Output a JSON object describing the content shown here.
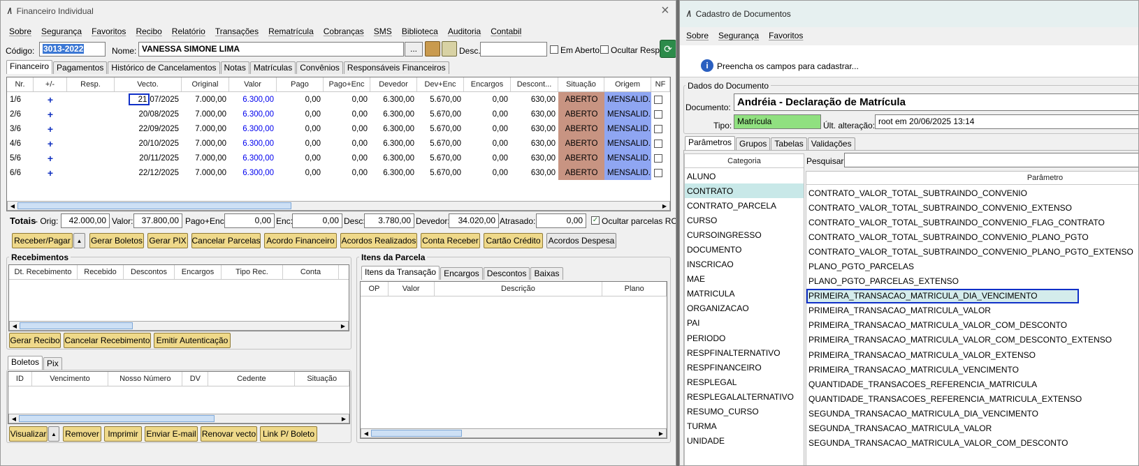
{
  "left": {
    "title": "Financeiro Individual",
    "close": "×",
    "menu": [
      "Sobre",
      "Segurança",
      "Favoritos",
      "Recibo",
      "Relatório",
      "Transações",
      "Rematrícula",
      "Cobranças",
      "SMS",
      "Biblioteca",
      "Auditoria",
      "Contabil"
    ],
    "codigo_label": "Código:",
    "codigo_value": "3013-2022",
    "nome_label": "Nome:",
    "nome_value": "VANESSA SIMONE LIMA",
    "dots": "...",
    "desc_label": "Desc.:",
    "desc_value": "",
    "em_aberto": "Em Aberto",
    "ocultar_resp": "Ocultar Resp.",
    "tabs": [
      "Financeiro",
      "Pagamentos",
      "Histórico de Cancelamentos",
      "Notas",
      "Matrículas",
      "Convênios",
      "Responsáveis Financeiros"
    ],
    "grid_headers": [
      "Nr.",
      "+/-",
      "Resp.",
      "Vecto.",
      "Original",
      "Valor",
      "Pago",
      "Pago+Enc",
      "Devedor",
      "Dev+Enc",
      "Encargos",
      "Descont...",
      "Situação",
      "Origem",
      "NF"
    ],
    "rows": [
      {
        "nr": "1/6",
        "pm": "+",
        "resp": "",
        "vecto": "21/07/2025",
        "vecto_day": "21",
        "vecto_rest": "07/2025",
        "original": "7.000,00",
        "valor": "6.300,00",
        "pago": "0,00",
        "pagoenc": "0,00",
        "devedor": "6.300,00",
        "devenc": "5.670,00",
        "encargos": "0,00",
        "desconto": "630,00",
        "situacao": "ABERTO",
        "origem": "MENSALID..."
      },
      {
        "nr": "2/6",
        "pm": "+",
        "resp": "",
        "vecto": "20/08/2025",
        "original": "7.000,00",
        "valor": "6.300,00",
        "pago": "0,00",
        "pagoenc": "0,00",
        "devedor": "6.300,00",
        "devenc": "5.670,00",
        "encargos": "0,00",
        "desconto": "630,00",
        "situacao": "ABERTO",
        "origem": "MENSALID..."
      },
      {
        "nr": "3/6",
        "pm": "+",
        "resp": "",
        "vecto": "22/09/2025",
        "original": "7.000,00",
        "valor": "6.300,00",
        "pago": "0,00",
        "pagoenc": "0,00",
        "devedor": "6.300,00",
        "devenc": "5.670,00",
        "encargos": "0,00",
        "desconto": "630,00",
        "situacao": "ABERTO",
        "origem": "MENSALID..."
      },
      {
        "nr": "4/6",
        "pm": "+",
        "resp": "",
        "vecto": "20/10/2025",
        "original": "7.000,00",
        "valor": "6.300,00",
        "pago": "0,00",
        "pagoenc": "0,00",
        "devedor": "6.300,00",
        "devenc": "5.670,00",
        "encargos": "0,00",
        "desconto": "630,00",
        "situacao": "ABERTO",
        "origem": "MENSALID..."
      },
      {
        "nr": "5/6",
        "pm": "+",
        "resp": "",
        "vecto": "20/11/2025",
        "original": "7.000,00",
        "valor": "6.300,00",
        "pago": "0,00",
        "pagoenc": "0,00",
        "devedor": "6.300,00",
        "devenc": "5.670,00",
        "encargos": "0,00",
        "desconto": "630,00",
        "situacao": "ABERTO",
        "origem": "MENSALID..."
      },
      {
        "nr": "6/6",
        "pm": "+",
        "resp": "",
        "vecto": "22/12/2025",
        "original": "7.000,00",
        "valor": "6.300,00",
        "pago": "0,00",
        "pagoenc": "0,00",
        "devedor": "6.300,00",
        "devenc": "5.670,00",
        "encargos": "0,00",
        "desconto": "630,00",
        "situacao": "ABERTO",
        "origem": "MENSALID..."
      }
    ],
    "totals": {
      "label": "Totais",
      "orig_label": "- Orig:",
      "orig": "42.000,00",
      "valor_label": "Valor:",
      "valor": "37.800,00",
      "pagoenc_label": "Pago+Enc:",
      "pagoenc": "0,00",
      "enc_label": "Enc:",
      "enc": "0,00",
      "desc_label": "Desc:",
      "desc": "3.780,00",
      "devedor_label": "Devedor:",
      "devedor": "34.020,00",
      "atrasado_label": "Atrasado:",
      "atrasado": "0,00",
      "ocultar": "Ocultar parcelas RC"
    },
    "actions": [
      "Receber/Pagar",
      "Gerar Boletos",
      "Gerar PIX",
      "Cancelar Parcelas",
      "Acordo Financeiro",
      "Acordos Realizados",
      "Conta Receber",
      "Cartão Crédito",
      "Acordos Despesa"
    ],
    "recebimentos": {
      "title": "Recebimentos",
      "headers": [
        "Dt. Recebimento",
        "Recebido",
        "Descontos",
        "Encargos",
        "Tipo Rec.",
        "Conta"
      ],
      "buttons": [
        "Gerar Recibo",
        "Cancelar Recebimento",
        "Emitir Autenticação"
      ]
    },
    "itens": {
      "title": "Itens da Parcela",
      "tabs": [
        "Itens da Transação",
        "Encargos",
        "Descontos",
        "Baixas"
      ],
      "headers": [
        "OP",
        "Valor",
        "Descrição",
        "Plano"
      ]
    },
    "boletos": {
      "tabs": [
        "Boletos",
        "Pix"
      ],
      "headers": [
        "ID",
        "Vencimento",
        "Nosso Número",
        "DV",
        "Cedente",
        "Situação"
      ],
      "buttons": [
        "Visualizar",
        "Remover",
        "Imprimir",
        "Enviar E-mail",
        "Renovar vecto",
        "Link P/ Boleto"
      ]
    }
  },
  "right": {
    "title": "Cadastro de Documentos",
    "menu": [
      "Sobre",
      "Segurança",
      "Favoritos"
    ],
    "info": "Preencha os campos para cadastrar...",
    "group_title": "Dados do Documento",
    "documento_label": "Documento:",
    "documento_value": "Andréia - Declaração de Matrícula",
    "tipo_label": "Tipo:",
    "tipo_value": "Matrícula",
    "ult_label": "Últ. alteração:",
    "ult_value": "root em 20/06/2025 13:14",
    "tabs": [
      "Parâmetros",
      "Grupos",
      "Tabelas",
      "Validações"
    ],
    "categoria_header": "Categoria",
    "pesquisar_label": "Pesquisar:",
    "parametro_header": "Parâmetro",
    "categorias": [
      "ALUNO",
      "CONTRATO",
      "CONTRATO_PARCELA",
      "CURSO",
      "CURSOINGRESSO",
      "DOCUMENTO",
      "INSCRICAO",
      "MAE",
      "MATRICULA",
      "ORGANIZACAO",
      "PAI",
      "PERIODO",
      "RESPFINALTERNATIVO",
      "RESPFINANCEIRO",
      "RESPLEGAL",
      "RESPLEGALALTERNATIVO",
      "RESUMO_CURSO",
      "TURMA",
      "UNIDADE"
    ],
    "parametros": [
      "CONTRATO_VALOR_TOTAL_SUBTRAINDO_CONVENIO",
      "CONTRATO_VALOR_TOTAL_SUBTRAINDO_CONVENIO_EXTENSO",
      "CONTRATO_VALOR_TOTAL_SUBTRAINDO_CONVENIO_FLAG_CONTRATO",
      "CONTRATO_VALOR_TOTAL_SUBTRAINDO_CONVENIO_PLANO_PGTO",
      "CONTRATO_VALOR_TOTAL_SUBTRAINDO_CONVENIO_PLANO_PGTO_EXTENSO",
      "PLANO_PGTO_PARCELAS",
      "PLANO_PGTO_PARCELAS_EXTENSO",
      "PRIMEIRA_TRANSACAO_MATRICULA_DIA_VENCIMENTO",
      "PRIMEIRA_TRANSACAO_MATRICULA_VALOR",
      "PRIMEIRA_TRANSACAO_MATRICULA_VALOR_COM_DESCONTO",
      "PRIMEIRA_TRANSACAO_MATRICULA_VALOR_COM_DESCONTO_EXTENSO",
      "PRIMEIRA_TRANSACAO_MATRICULA_VALOR_EXTENSO",
      "PRIMEIRA_TRANSACAO_MATRICULA_VENCIMENTO",
      "QUANTIDADE_TRANSACOES_REFERENCIA_MATRICULA",
      "QUANTIDADE_TRANSACOES_REFERENCIA_MATRICULA_EXTENSO",
      "SEGUNDA_TRANSACAO_MATRICULA_DIA_VENCIMENTO",
      "SEGUNDA_TRANSACAO_MATRICULA_VALOR",
      "SEGUNDA_TRANSACAO_MATRICULA_VALOR_COM_DESCONTO"
    ]
  },
  "colors": {
    "valor_blue": "#0000ee",
    "situacao_bg": "#c89482",
    "origem_bg": "#8fa6f2",
    "button_yellow": "#efd98a",
    "selected_cat": "#c8e8e8",
    "selected_param": "#d4ecec",
    "tipo_green": "#90e080"
  }
}
